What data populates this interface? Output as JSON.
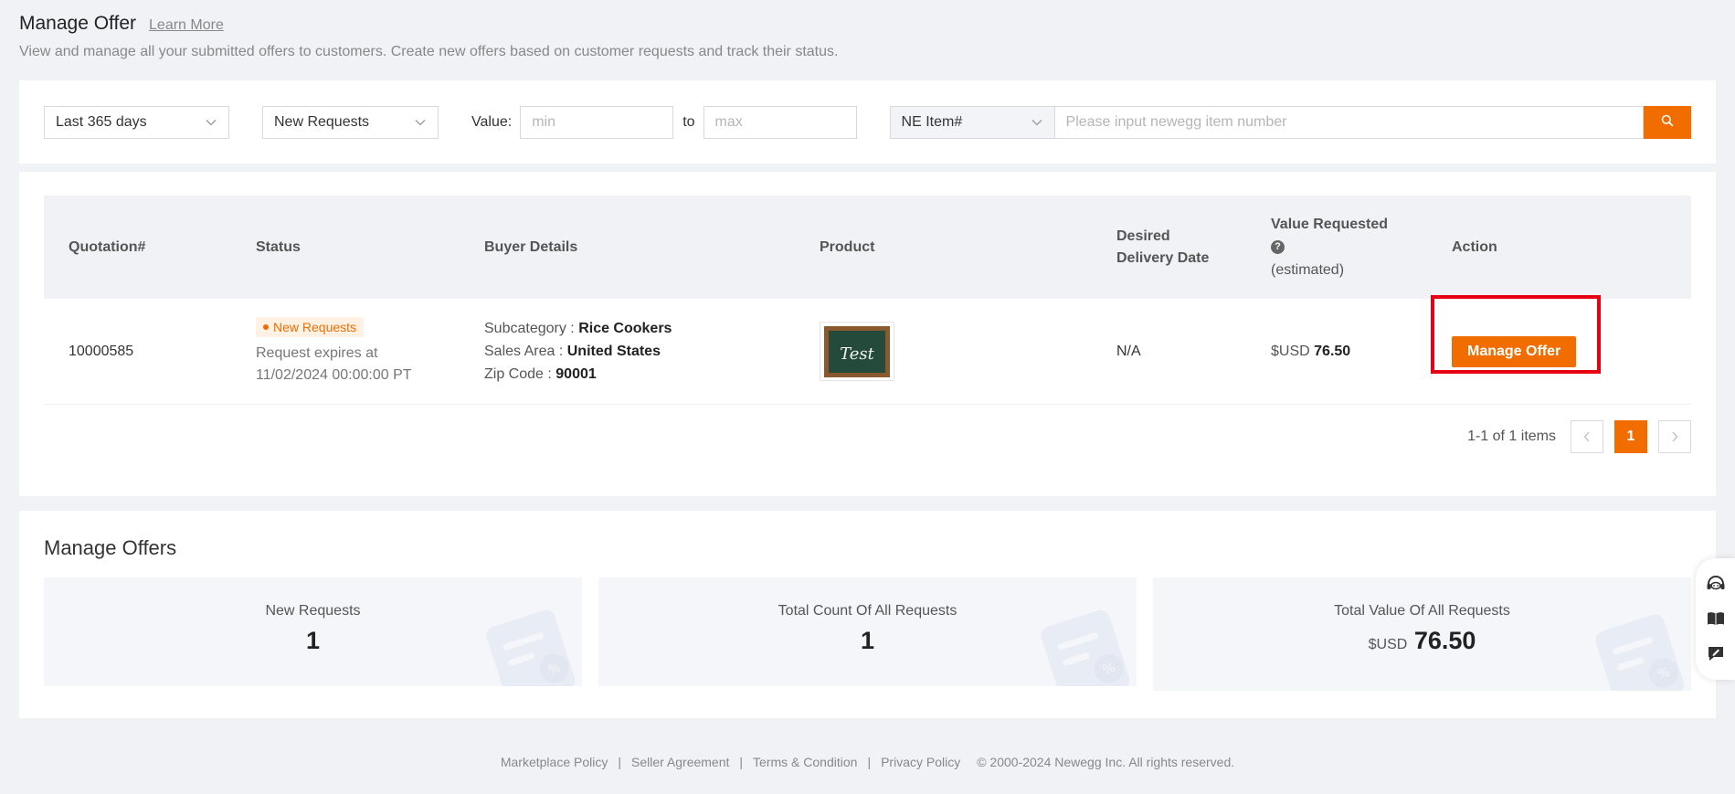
{
  "header": {
    "title": "Manage Offer",
    "learn_more": "Learn More",
    "description": "View and manage all your submitted offers to customers. Create new offers based on customer requests and track their status."
  },
  "filters": {
    "period": "Last 365 days",
    "status": "New Requests",
    "value_label": "Value:",
    "min_placeholder": "min",
    "to_label": "to",
    "max_placeholder": "max",
    "search_type": "NE Item#",
    "search_placeholder": "Please input newegg item number"
  },
  "table": {
    "headers": {
      "quotation": "Quotation#",
      "status": "Status",
      "buyer": "Buyer Details",
      "product": "Product",
      "delivery_1": "Desired",
      "delivery_2": "Delivery Date",
      "value_1": "Value Requested",
      "value_3": "(estimated)",
      "action": "Action"
    },
    "rows": [
      {
        "quotation": "10000585",
        "status_badge": "New Requests",
        "expires_1": "Request expires at",
        "expires_2": "11/02/2024 00:00:00 PT",
        "subcategory_label": "Subcategory :",
        "subcategory": "Rice Cookers",
        "sales_area_label": "Sales Area :",
        "sales_area": "United States",
        "zip_label": "Zip Code :",
        "zip": "90001",
        "product_image_text": "Test",
        "delivery_date": "N/A",
        "value_currency": "$USD",
        "value_amount": "76.50",
        "action_label": "Manage Offer"
      }
    ]
  },
  "pagination": {
    "info": "1-1 of 1 items",
    "current_page": "1",
    "prev": "<",
    "next": ">"
  },
  "stats": {
    "title": "Manage Offers",
    "cards": [
      {
        "label": "New Requests",
        "value": "1"
      },
      {
        "label": "Total Count Of All Requests",
        "value": "1"
      },
      {
        "label": "Total Value Of All Requests",
        "currency": "$USD",
        "value": "76.50"
      }
    ]
  },
  "footer": {
    "links": [
      "Marketplace Policy",
      "Seller Agreement",
      "Terms & Condition",
      "Privacy Policy"
    ],
    "separator": "|",
    "copyright": "© 2000-2024 Newegg Inc. All rights reserved."
  },
  "colors": {
    "accent": "#f26d00",
    "highlight": "#e60012",
    "background": "#f1f2f6"
  },
  "icons": [
    "chevron-down-icon",
    "search-icon",
    "help-icon",
    "headset-icon",
    "book-icon",
    "feedback-icon"
  ]
}
